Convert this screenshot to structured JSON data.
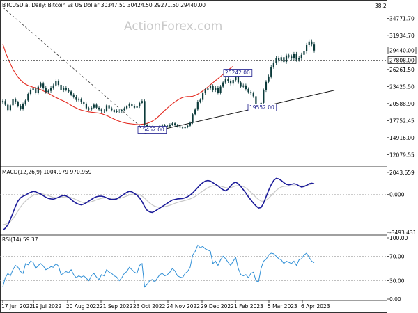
{
  "header": {
    "instrument": "BTCUSD.a, Daily:  Bitcoin vs US Dollar  30347.50 30424.50 29271.50 29440.00",
    "corner_value": "38.2",
    "watermark": "ActionForex.com"
  },
  "chart_data": [
    {
      "type": "candlestick",
      "pane": "price",
      "x_ticks": [
        "17 Jun 2022",
        "19 Jul 2022",
        "20 Aug 2022",
        "21 Sep 2022",
        "23 Oct 2022",
        "24 Nov 2022",
        "29 Dec 2022",
        "1 Feb 2023",
        "5 Mar 2023",
        "6 Apr 2023"
      ],
      "y_ticks": [
        "34771.70",
        "31934.70",
        "26261.50",
        "23425.50",
        "20588.90",
        "17752.45",
        "14916.00",
        "12079.55"
      ],
      "current_price": "29440.00",
      "horizontal_level": "27808.00",
      "price_labels": [
        "25242.00",
        "19552.00",
        "15452.00"
      ],
      "ohlc_last": {
        "open": 30347.5,
        "high": 30424.5,
        "low": 29271.5,
        "close": 29440.0
      },
      "ylim": [
        10500,
        36200
      ],
      "close_series": [
        21000,
        20400,
        19500,
        20300,
        21300,
        20800,
        20200,
        19700,
        20500,
        21100,
        22200,
        22800,
        23100,
        22400,
        23400,
        23900,
        23200,
        22500,
        22700,
        23200,
        23600,
        24300,
        23700,
        22800,
        23200,
        22900,
        22600,
        22100,
        21700,
        21200,
        21300,
        20800,
        20500,
        19800,
        19600,
        19900,
        20400,
        19900,
        19600,
        19300,
        19400,
        20300,
        19800,
        19500,
        19200,
        19400,
        19300,
        19500,
        19800,
        20100,
        20500,
        20200,
        19900,
        20100,
        20700,
        21000,
        17100,
        16400,
        16700,
        16500,
        16200,
        16600,
        16900,
        17000,
        16900,
        16800,
        17100,
        17300,
        17000,
        16800,
        16600,
        16500,
        16700,
        16900,
        17400,
        18800,
        19600,
        20900,
        21200,
        22300,
        22900,
        23100,
        23500,
        22800,
        23200,
        22400,
        23400,
        24100,
        24700,
        24300,
        23900,
        24500,
        25200,
        24100,
        23400,
        23600,
        23000,
        22500,
        22300,
        21800,
        20200,
        19700,
        20700,
        22800,
        24200,
        25100,
        26700,
        27300,
        28100,
        27800,
        28300,
        27500,
        28600,
        28400,
        28100,
        28800,
        27900,
        28200,
        28700,
        29300,
        30300,
        30900,
        30500,
        29400
      ],
      "ma_series": [
        30500,
        29200,
        28100,
        27200,
        26300,
        25600,
        25000,
        24500,
        24100,
        23800,
        23600,
        23450,
        23300,
        23200,
        23050,
        22900,
        22700,
        22500,
        22300,
        22050,
        21800,
        21600,
        21400,
        21200,
        21000,
        20800,
        20550,
        20300,
        20050,
        19850,
        19650,
        19500,
        19400,
        19300,
        19200,
        19150,
        19100,
        19050,
        19000,
        18900,
        18750,
        18600,
        18400,
        18200,
        18000,
        17800,
        17650,
        17500,
        17400,
        17300,
        17250,
        17200,
        17150,
        17100,
        17100,
        17150,
        17200,
        17300,
        17450,
        17650,
        17900,
        18250,
        18650,
        19050,
        19450,
        19850,
        20200,
        20550,
        20850,
        21150,
        21400,
        21600,
        21700,
        21750,
        21750,
        21800,
        21950,
        22150,
        22400,
        22700,
        23000,
        23350,
        23700,
        24050,
        24400,
        24750,
        25100,
        25450,
        25800,
        26150,
        26500,
        26800
      ],
      "sma_label": "",
      "trendline_start_index": 56,
      "trendline_start_value": 15600,
      "trendline_end_index": 131,
      "trendline_end_value": 22800,
      "dashed_line_start_value": 37000,
      "dashed_line_end_index": 57,
      "dashed_line_end_value": 15800
    },
    {
      "type": "line",
      "pane": "macd",
      "title": "MACD(12,26,9) 1004.979 970.959",
      "y_ticks": [
        "2043.659",
        "0.000",
        "-3493.431"
      ],
      "ylim": [
        -3493.431,
        2043.659
      ],
      "macd_series": [
        -3300,
        -3100,
        -2800,
        -2300,
        -1700,
        -1100,
        -600,
        -300,
        -150,
        -50,
        100,
        200,
        300,
        250,
        150,
        50,
        -100,
        -250,
        -350,
        -400,
        -420,
        -350,
        -250,
        -150,
        -80,
        -120,
        -250,
        -450,
        -650,
        -800,
        -900,
        -950,
        -880,
        -750,
        -600,
        -450,
        -300,
        -200,
        -150,
        -150,
        -200,
        -300,
        -400,
        -450,
        -450,
        -400,
        -250,
        -100,
        50,
        200,
        300,
        250,
        100,
        -50,
        -300,
        -650,
        -1100,
        -1450,
        -1600,
        -1650,
        -1550,
        -1400,
        -1250,
        -1100,
        -950,
        -800,
        -650,
        -500,
        -450,
        -400,
        -380,
        -360,
        -300,
        -200,
        -50,
        150,
        400,
        650,
        900,
        1100,
        1250,
        1300,
        1250,
        1100,
        950,
        800,
        600,
        450,
        350,
        500,
        800,
        1050,
        1150,
        1000,
        750,
        450,
        150,
        -200,
        -500,
        -800,
        -1050,
        -1250,
        -1200,
        -800,
        -200,
        400,
        900,
        1300,
        1500,
        1450,
        1300,
        1100,
        950,
        900,
        950,
        1000,
        950,
        800,
        700,
        750,
        850,
        1000,
        1050,
        1004.979
      ],
      "signal_series": [
        -2800,
        -2750,
        -2650,
        -2500,
        -2250,
        -1900,
        -1500,
        -1150,
        -850,
        -600,
        -400,
        -220,
        -80,
        20,
        60,
        70,
        40,
        -20,
        -100,
        -180,
        -260,
        -300,
        -300,
        -270,
        -230,
        -200,
        -220,
        -280,
        -370,
        -480,
        -590,
        -680,
        -740,
        -750,
        -720,
        -660,
        -580,
        -490,
        -410,
        -350,
        -310,
        -300,
        -320,
        -340,
        -360,
        -370,
        -350,
        -300,
        -220,
        -130,
        -40,
        30,
        60,
        40,
        -20,
        -140,
        -330,
        -560,
        -780,
        -950,
        -1080,
        -1150,
        -1180,
        -1160,
        -1120,
        -1060,
        -990,
        -900,
        -810,
        -730,
        -660,
        -600,
        -540,
        -480,
        -400,
        -300,
        -170,
        -10,
        160,
        330,
        490,
        630,
        740,
        800,
        820,
        810,
        770,
        710,
        640,
        610,
        640,
        720,
        800,
        830,
        810,
        740,
        620,
        440,
        210,
        -20,
        -250,
        -450,
        -600,
        -620,
        -520,
        -330,
        -100,
        150,
        380,
        570,
        700,
        760,
        780,
        790,
        800,
        810,
        800,
        790,
        790,
        810,
        850,
        900,
        970.959
      ]
    },
    {
      "type": "line",
      "pane": "rsi",
      "title": "RSI(14) 59.37",
      "y_ticks": [
        "100.00",
        "70.00",
        "30.00",
        "0.00"
      ],
      "levels": [
        70,
        30
      ],
      "ylim": [
        0,
        100
      ],
      "rsi_series": [
        20,
        35,
        42,
        38,
        48,
        55,
        52,
        45,
        42,
        58,
        56,
        62,
        60,
        50,
        55,
        58,
        54,
        48,
        50,
        53,
        52,
        58,
        54,
        40,
        42,
        45,
        43,
        48,
        40,
        35,
        38,
        36,
        38,
        34,
        30,
        38,
        42,
        36,
        32,
        40,
        38,
        48,
        44,
        42,
        38,
        36,
        30,
        35,
        42,
        45,
        52,
        48,
        44,
        42,
        55,
        58,
        20,
        24,
        30,
        32,
        28,
        34,
        40,
        42,
        38,
        40,
        44,
        50,
        46,
        38,
        36,
        35,
        42,
        45,
        52,
        72,
        78,
        88,
        84,
        86,
        82,
        80,
        78,
        58,
        62,
        55,
        64,
        70,
        66,
        60,
        55,
        62,
        68,
        50,
        40,
        38,
        40,
        35,
        42,
        44,
        30,
        28,
        50,
        62,
        65,
        72,
        75,
        74,
        70,
        66,
        64,
        58,
        62,
        60,
        58,
        62,
        55,
        64,
        66,
        72,
        75,
        68,
        62,
        59.37
      ]
    }
  ]
}
